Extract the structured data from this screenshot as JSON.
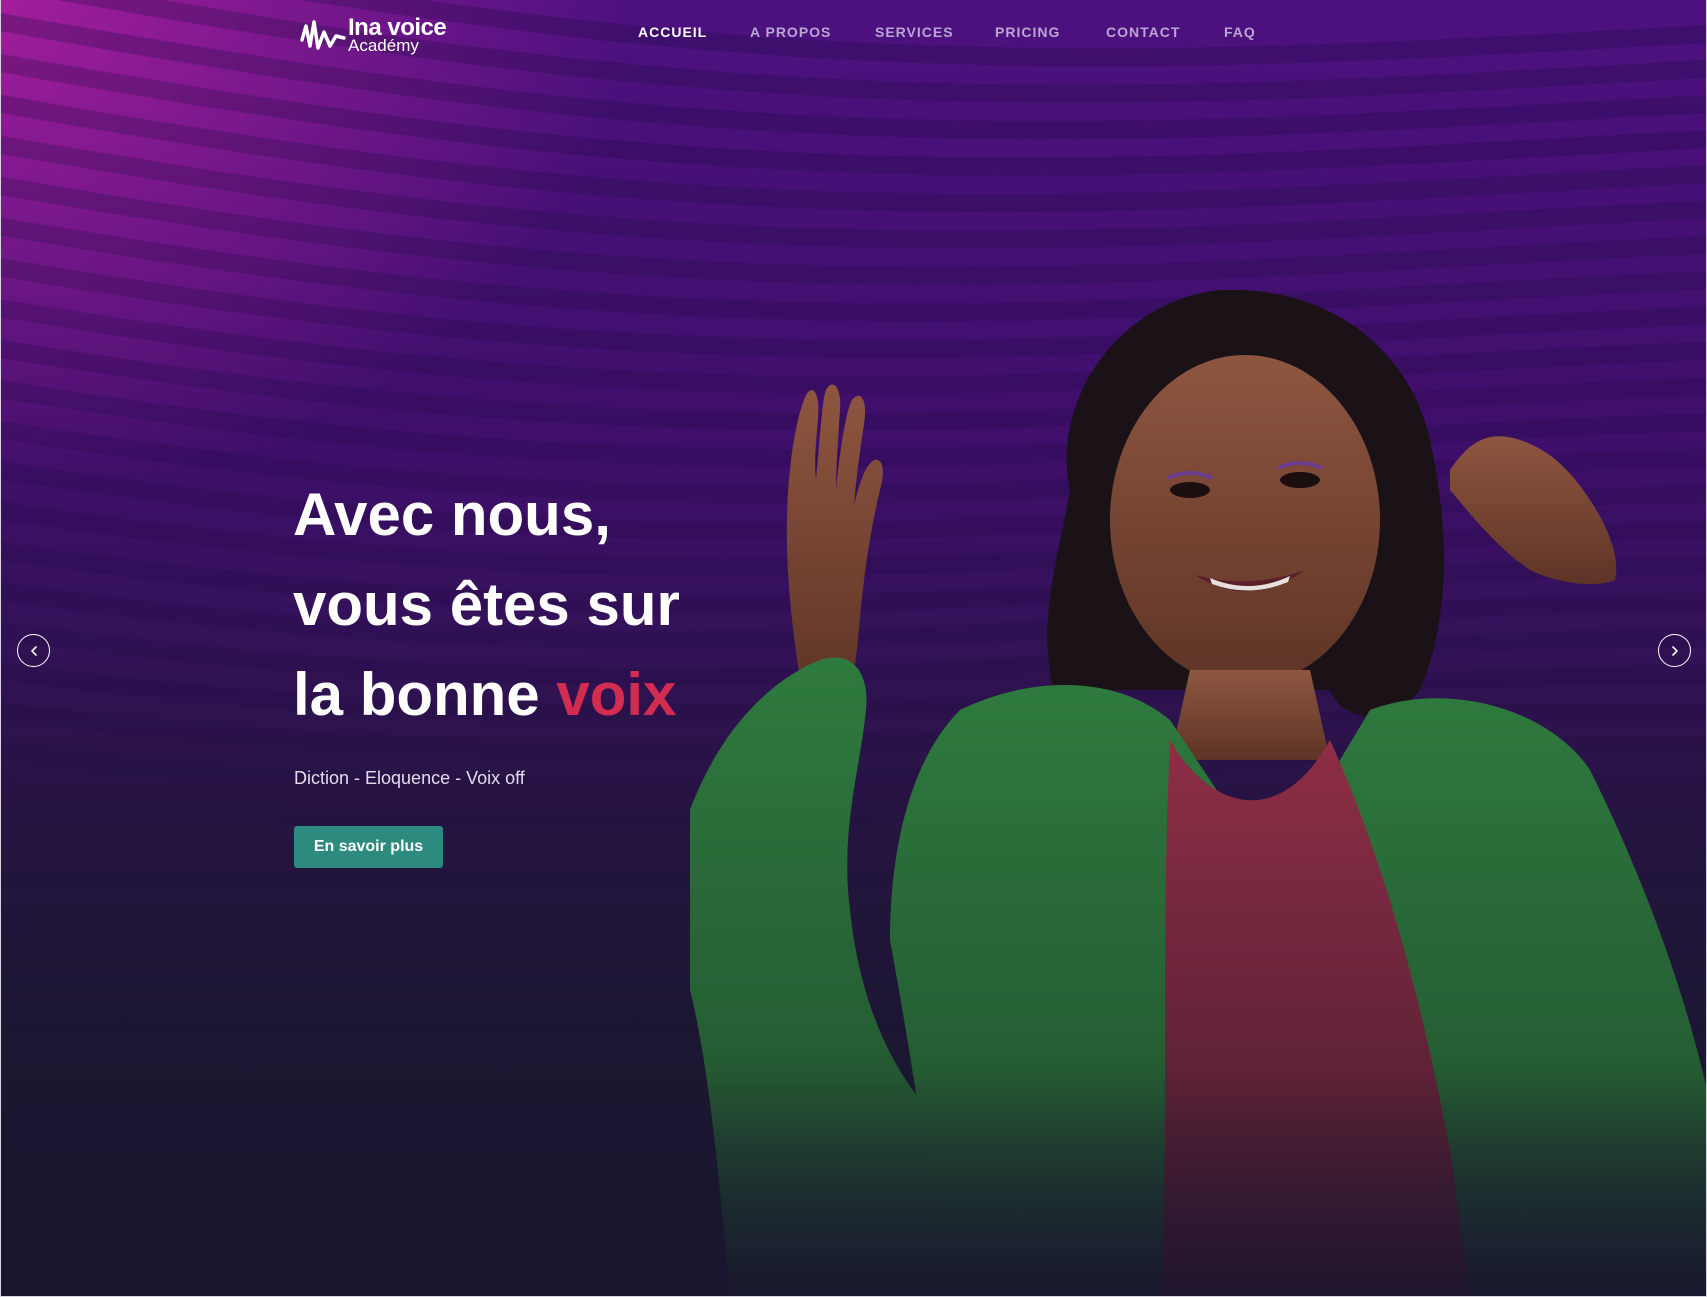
{
  "header": {
    "brand_line1": "Ina voice",
    "brand_line2": "Académy",
    "nav": [
      {
        "label": "ACCUEIL",
        "active": true
      },
      {
        "label": "A PROPOS",
        "active": false
      },
      {
        "label": "SERVICES",
        "active": false
      },
      {
        "label": "PRICING",
        "active": false
      },
      {
        "label": "CONTACT",
        "active": false
      },
      {
        "label": "FAQ",
        "active": false
      }
    ]
  },
  "hero": {
    "headline_line1": "Avec nous,",
    "headline_line2": "vous êtes sur",
    "headline_line3_prefix": "la bonne ",
    "headline_line3_accent": "voix",
    "subtitle": "Diction - Eloquence - Voix off",
    "cta_label": "En savoir plus"
  },
  "carousel": {
    "prev_icon": "chevron-left-icon",
    "next_icon": "chevron-right-icon"
  },
  "colors": {
    "accent": "#d22c50",
    "cta": "#2c8b7e",
    "background_top": "#4d117f",
    "background_bottom": "#1a1630",
    "jacket": "#2e6f3a"
  }
}
